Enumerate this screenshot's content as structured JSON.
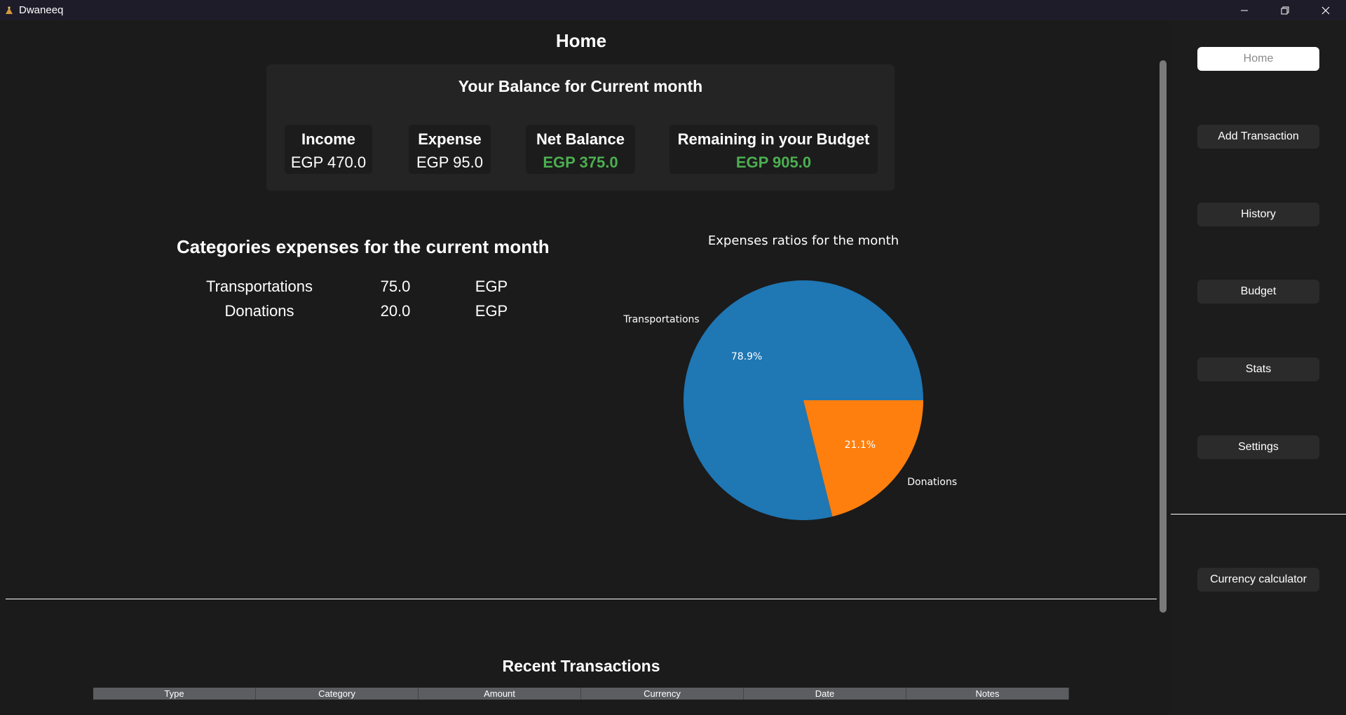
{
  "window": {
    "title": "Dwaneeq"
  },
  "page": {
    "title": "Home"
  },
  "balance": {
    "title": "Your Balance for Current month",
    "cards": [
      {
        "label": "Income",
        "value": "EGP 470.0"
      },
      {
        "label": "Expense",
        "value": "EGP 95.0"
      },
      {
        "label": "Net Balance",
        "value": "EGP 375.0"
      },
      {
        "label": "Remaining in your Budget",
        "value": "EGP 905.0"
      }
    ],
    "positive_color": "#4caf50"
  },
  "categories": {
    "title": "Categories expenses for the current month",
    "rows": [
      {
        "name": "Transportations",
        "amount": "75.0",
        "currency": "EGP"
      },
      {
        "name": "Donations",
        "amount": "20.0",
        "currency": "EGP"
      }
    ]
  },
  "chart_data": {
    "type": "pie",
    "title": "Expenses ratios for the month",
    "categories": [
      "Transportations",
      "Donations"
    ],
    "values": [
      78.9,
      21.1
    ],
    "labels": [
      "78.9%",
      "21.1%"
    ],
    "colors": [
      "#1f77b4",
      "#ff7f0e"
    ]
  },
  "recent": {
    "title": "Recent Transactions",
    "columns": [
      "Type",
      "Category",
      "Amount",
      "Currency",
      "Date",
      "Notes"
    ]
  },
  "sidebar": {
    "items": [
      {
        "label": "Home",
        "active": true
      },
      {
        "label": "Add Transaction"
      },
      {
        "label": "History"
      },
      {
        "label": "Budget"
      },
      {
        "label": "Stats"
      },
      {
        "label": "Settings"
      },
      {
        "label": "Currency calculator"
      }
    ]
  }
}
